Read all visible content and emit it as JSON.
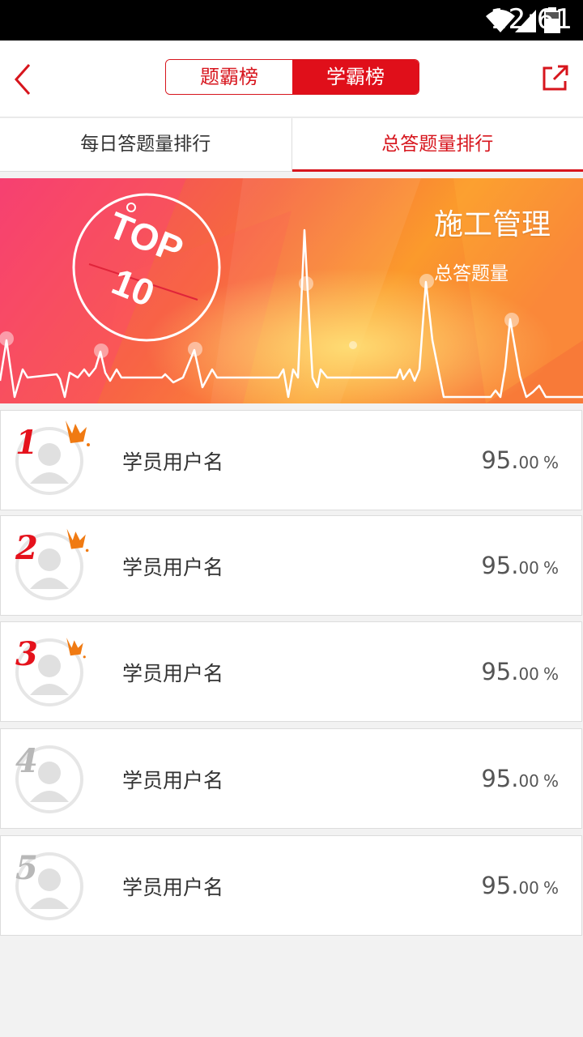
{
  "status_bar": {
    "time": "12:61"
  },
  "header": {
    "segments": [
      "题霸榜",
      "学霸榜"
    ],
    "active_segment": 1
  },
  "tabs": [
    "每日答题量排行",
    "总答题量排行"
  ],
  "banner": {
    "badge_line1": "TOP",
    "badge_line2": "10",
    "title": "施工管理",
    "subtitle": "总答题量"
  },
  "ranking": [
    {
      "rank": "1",
      "name": "学员用户名",
      "percent_int": "95.",
      "percent_dec": "00",
      "unit": "%",
      "crown": true
    },
    {
      "rank": "2",
      "name": "学员用户名",
      "percent_int": "95.",
      "percent_dec": "00",
      "unit": "%",
      "crown": true
    },
    {
      "rank": "3",
      "name": "学员用户名",
      "percent_int": "95.",
      "percent_dec": "00",
      "unit": "%",
      "crown": true
    },
    {
      "rank": "4",
      "name": "学员用户名",
      "percent_int": "95.",
      "percent_dec": "00",
      "unit": "%",
      "crown": false
    },
    {
      "rank": "5",
      "name": "学员用户名",
      "percent_int": "95.",
      "percent_dec": "00",
      "unit": "%",
      "crown": false
    }
  ],
  "colors": {
    "accent": "#e00f1a",
    "crown": "#f07a12",
    "rank_other": "#b8b8b8"
  }
}
